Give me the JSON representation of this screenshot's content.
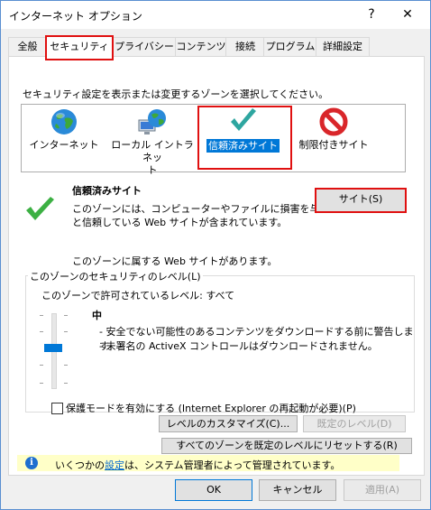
{
  "window": {
    "title": "インターネット オプション",
    "help": "?",
    "close": "✕"
  },
  "tabs": [
    "全般",
    "セキュリティ",
    "プライバシー",
    "コンテンツ",
    "接続",
    "プログラム",
    "詳細設定"
  ],
  "zone_prompt": "セキュリティ設定を表示または変更するゾーンを選択してください。",
  "zones": [
    {
      "label": "インターネット",
      "icon": "globe-icon"
    },
    {
      "label_line1": "ローカル イントラネッ",
      "label_line2": "ト",
      "icon": "intranet-icon"
    },
    {
      "label": "信頼済みサイト",
      "icon": "checkmark-icon",
      "selected": true
    },
    {
      "label": "制限付きサイト",
      "icon": "restricted-icon"
    }
  ],
  "selected_zone": {
    "name": "信頼済みサイト",
    "description_line1": "このゾーンには、コンピューターやファイルに損害を与えない",
    "description_line2": "と信頼している Web サイトが含まれています。",
    "sites_button": "サイト(S)",
    "has_sites_text": "このゾーンに属する Web サイトがあります。"
  },
  "security_level": {
    "group_title": "このゾーンのセキュリティのレベル(L)",
    "allowed_text": "このゾーンで許可されているレベル: すべて",
    "level": "中",
    "bullet1": "- 安全でない可能性のあるコンテンツをダウンロードする前に警告します。",
    "bullet2": "- 未署名の ActiveX コントロールはダウンロードされません。",
    "slider_position": "中"
  },
  "protected_mode": {
    "label": "保護モードを有効にする (Internet Explorer の再起動が必要)(P)",
    "checked": false
  },
  "buttons": {
    "custom_level": "レベルのカスタマイズ(C)...",
    "default_level": "既定のレベル(D)",
    "reset_all": "すべてのゾーンを既定のレベルにリセットする(R)",
    "ok": "OK",
    "cancel": "キャンセル",
    "apply": "適用(A)"
  },
  "info": {
    "prefix": "いくつかの",
    "link": "設定",
    "suffix": "は、システム管理者によって管理されています。"
  },
  "colors": {
    "accent": "#0078d7",
    "highlight_frame": "#e01010",
    "info_bg": "#ffffc8"
  }
}
